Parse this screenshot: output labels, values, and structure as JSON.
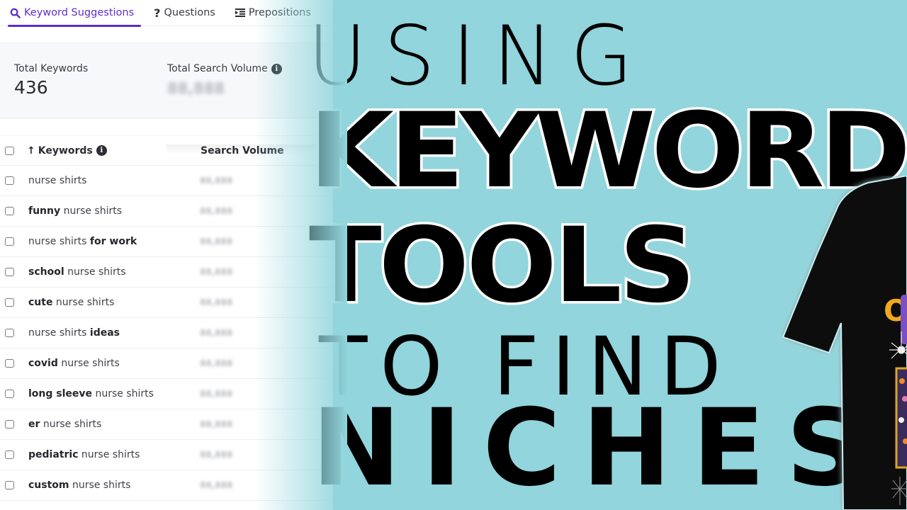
{
  "tabs": [
    {
      "label": "Keyword Suggestions",
      "icon": "search-icon",
      "active": true
    },
    {
      "label": "Questions",
      "icon": "question-icon",
      "active": false
    },
    {
      "label": "Prepositions",
      "icon": "indent-list-icon",
      "active": false
    }
  ],
  "stats": {
    "total_keywords_label": "Total Keywords",
    "total_keywords_value": "436",
    "total_search_volume_label": "Total Search Volume",
    "total_search_volume_value": "88,888"
  },
  "table": {
    "columns": {
      "keywords": "Keywords",
      "sort_indicator": "↑",
      "search_volume": "Search Volume"
    },
    "rows": [
      {
        "pre": "",
        "bold": "",
        "post": "nurse shirts",
        "volume": "88,888"
      },
      {
        "pre": "",
        "bold": "funny",
        "post": " nurse shirts",
        "volume": "88,888"
      },
      {
        "pre": "nurse shirts ",
        "bold": "for work",
        "post": "",
        "volume": "88,888"
      },
      {
        "pre": "",
        "bold": "school",
        "post": " nurse shirts",
        "volume": "88,888"
      },
      {
        "pre": "",
        "bold": "cute",
        "post": " nurse shirts",
        "volume": "88,888"
      },
      {
        "pre": "nurse shirts ",
        "bold": "ideas",
        "post": "",
        "volume": "88,888"
      },
      {
        "pre": "",
        "bold": "covid",
        "post": " nurse shirts",
        "volume": "88,888"
      },
      {
        "pre": "",
        "bold": "long sleeve",
        "post": " nurse shirts",
        "volume": "88,888"
      },
      {
        "pre": "",
        "bold": "er",
        "post": " nurse shirts",
        "volume": "88,888"
      },
      {
        "pre": "",
        "bold": "pediatric",
        "post": " nurse shirts",
        "volume": "88,888"
      },
      {
        "pre": "",
        "bold": "custom",
        "post": " nurse shirts",
        "volume": "88,888"
      }
    ]
  },
  "headline": {
    "line1": "USING",
    "line2": "KEYWORD",
    "line3": "TOOLS",
    "line4": "TO FIND",
    "line5": "NICHES"
  },
  "tshirt": {
    "print_text": "ON"
  },
  "colors": {
    "accent": "#5b2fc9",
    "background": "#92d5dc",
    "shirt": "#111111",
    "print_orange": "#f2a81d",
    "print_purple": "#7a4fc0"
  }
}
